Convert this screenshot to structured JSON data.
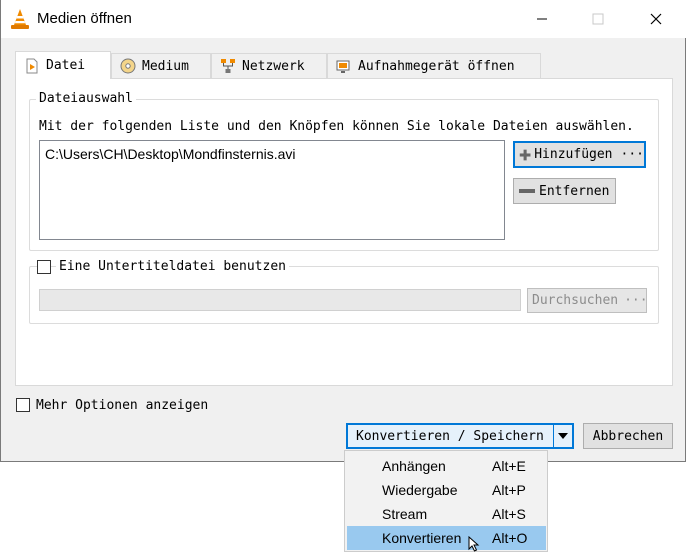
{
  "window": {
    "title": "Medien öffnen"
  },
  "tabs": [
    {
      "label": "Datei",
      "icon": "file-icon"
    },
    {
      "label": "Medium",
      "icon": "disc-icon"
    },
    {
      "label": "Netzwerk",
      "icon": "network-icon"
    },
    {
      "label": "Aufnahmegerät öffnen",
      "icon": "capture-device-icon"
    }
  ],
  "file_selection": {
    "group_title": "Dateiauswahl",
    "description": "Mit der folgenden Liste und den Knöpfen können Sie lokale Dateien auswählen.",
    "files": [
      "C:\\Users\\CH\\Desktop\\Mondfinsternis.avi"
    ],
    "add_label": "Hinzufügen",
    "add_ellipsis": "···",
    "remove_label": "Entfernen"
  },
  "subtitle": {
    "checkbox_label": "Eine Untertiteldatei benutzen",
    "path_value": "",
    "browse_label": "Durchsuchen",
    "browse_ellipsis": "···"
  },
  "more_options": {
    "label": "Mehr Optionen anzeigen"
  },
  "actions": {
    "convert_label": "Konvertieren / Speichern",
    "cancel_label": "Abbrechen"
  },
  "dropdown": {
    "items": [
      {
        "label": "Anhängen",
        "shortcut": "Alt+E"
      },
      {
        "label": "Wiedergabe",
        "shortcut": "Alt+P"
      },
      {
        "label": "Stream",
        "shortcut": "Alt+S"
      },
      {
        "label": "Konvertieren",
        "shortcut": "Alt+O"
      }
    ],
    "highlighted_index": 3
  },
  "colors": {
    "accent": "#0078d7",
    "highlight": "#99c9ef",
    "vlc_orange": "#f08a00"
  }
}
